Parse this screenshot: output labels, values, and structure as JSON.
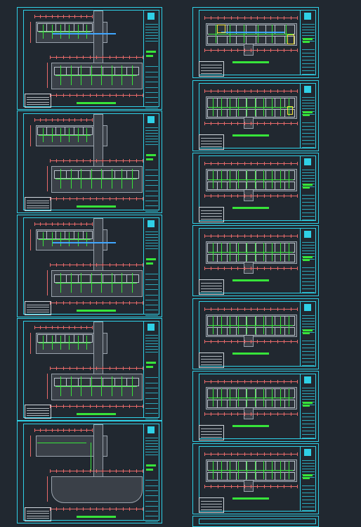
{
  "app": {
    "window_title": ""
  },
  "colors": {
    "background": "#212830",
    "frame": "#2fd0e6",
    "pipe": "#37e43a",
    "dimension": "#e86a6a",
    "walls": "#9aa3ad",
    "duct": "#3fa6ff",
    "highlight": "#f2e23a"
  },
  "layout_columns": [
    "left",
    "right"
  ],
  "sheets": {
    "left": [
      {
        "id": "L1",
        "style": "L-shaped"
      },
      {
        "id": "L2",
        "style": "L-shaped"
      },
      {
        "id": "L3",
        "style": "L-shaped"
      },
      {
        "id": "L4",
        "style": "L-shaped"
      },
      {
        "id": "L5",
        "style": "L-shaped-outline"
      }
    ],
    "right": [
      {
        "id": "R1",
        "style": "bar"
      },
      {
        "id": "R2",
        "style": "bar"
      },
      {
        "id": "R3",
        "style": "bar"
      },
      {
        "id": "R4",
        "style": "bar"
      },
      {
        "id": "R5",
        "style": "bar"
      },
      {
        "id": "R6",
        "style": "bar"
      },
      {
        "id": "R7",
        "style": "bar"
      },
      {
        "id": "R8",
        "style": "bar-partial"
      }
    ]
  },
  "icons": {
    "logo": "square-logo-icon"
  }
}
